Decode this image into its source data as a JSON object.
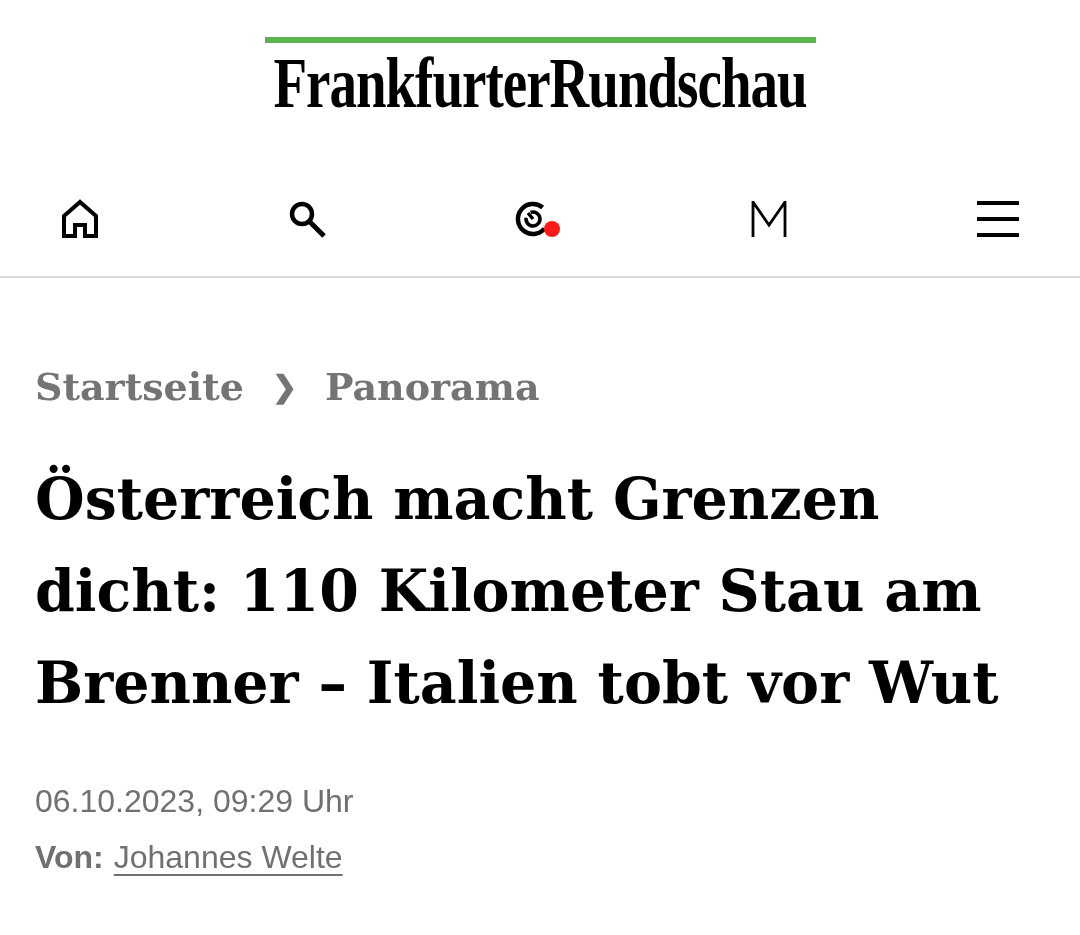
{
  "logo": {
    "text": "FrankfurterRundschau"
  },
  "nav": {
    "notification_dot": true
  },
  "breadcrumb": {
    "items": [
      "Startseite",
      "Panorama"
    ],
    "separator": "❯"
  },
  "headline": "Österreich macht Grenzen dicht: 110 Kilometer Stau am Brenner – Italien tobt vor Wut",
  "meta": {
    "date": "06.10.2023, 09:29 Uhr",
    "author_label": "Von:",
    "author": "Johannes Welte"
  }
}
